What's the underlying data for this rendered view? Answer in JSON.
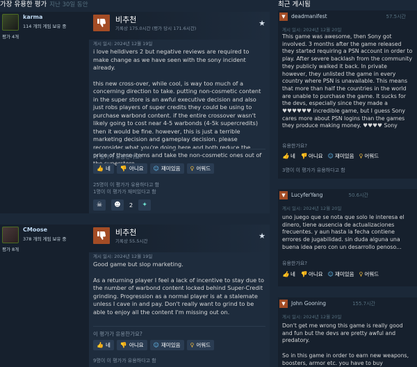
{
  "left_header": {
    "title": "가장 유용한 평가",
    "subtitle": "지난 30일 동안"
  },
  "right_header": {
    "title": "최근 게시됨"
  },
  "reviews": [
    {
      "author": "karma",
      "owned": "114 개의 게임 보유 중",
      "review_count": "평가 4개",
      "verdict": "비추천",
      "hours": "기록상 175.0시간 (평가 당시 171.6시간)",
      "posted": "게시 일시: 2024년 12월 19일",
      "paragraphs": [
        "i love helldivers 2 but negative reviews are required to make change as we have seen with the sony incident already.",
        "this new cross-over, while cool, is way too much of a concerning direction to take. putting non-cosmetic content in the super store is an awful executive decision and also just robs players of super credits they could be using to purchase warbond content. if the entire crossover wasn't likely going to cost near 4-5 warbonds (4-5k supercredits) then it would be fine. however, this is just a terrible marketing decision and gameplay decision. please reconsider what you're doing here and both reduce the price of these items and take the non-cosmetic ones out of the superstore."
      ],
      "helpful_question": "이 평가가 유용한가요?",
      "buttons": {
        "yes": "네",
        "no": "아니요",
        "funny": "재미있음",
        "award": "어워드"
      },
      "stats": [
        "25명이 이 평가가 유용하다고 함",
        "1명이 이 평가가 재미있다고 함"
      ],
      "award_count": "2"
    },
    {
      "author": "CMoose",
      "owned": "378 개의 게임 보유 중",
      "review_count": "평가 8개",
      "verdict": "비추천",
      "hours": "기록상 55.5시간",
      "posted": "게시 일시: 2024년 12월 19일",
      "paragraphs": [
        "Good game but slop marketing.",
        "As a returning player I feel a lack of incentive to stay due to the number of warbond content locked behind Super-Credit grinding. Progression as a normal player is at a stalemate unless I cave in and pay. Don't really want to grind to be able to enjoy all the content I'm missing out on."
      ],
      "helpful_question": "이 평가가 유용한가요?",
      "buttons": {
        "yes": "네",
        "no": "아니요",
        "funny": "재미있음",
        "award": "어워드"
      },
      "stats": [
        "9명이 이 평가가 유용하다고 함"
      ]
    }
  ],
  "recent": [
    {
      "author": "deadmanifest",
      "hours": "57.5시간",
      "posted": "게시 일시: 2024년 12월 20일",
      "text": "This game was awesome, then Sony got involved. 3 months after the game released they started requiring a PSN account in order to play. After severe backlash from the community they publicly walked it back. In private however, they unlisted the game in every country where PSN is unavailable. This means that more than half the countries in the world are unable to purchase the game. It sucks for the devs, especially since they made a ♥♥♥♥♥♥ incredible game, but I guess Sony cares more about PSN logins than the games they produce making money. ♥♥♥♥ Sony",
      "helpful_question": "유용한가요?",
      "buttons": {
        "yes": "네",
        "no": "아니요",
        "funny": "재미있음",
        "award": "어워드"
      },
      "stat": "3명이 이 평가가 유용하다고 함"
    },
    {
      "author": "LucyferYang",
      "hours": "50.6시간",
      "posted": "게시 일시: 2024년 12월 20일",
      "text": "uno juego que se nota que solo le interesa el dinero, tiene ausencia de actualizaciones frecuentes. y aun hasta la fecha contiene errores de jugabilidad. sin duda alguna una buena idea pero con un desarrollo penoso...",
      "helpful_question": "유용한가요?",
      "buttons": {
        "yes": "네",
        "no": "아니요",
        "funny": "재미있음",
        "award": "어워드"
      }
    },
    {
      "author": "John Gooning",
      "hours": "155.7시간",
      "posted": "게시 일시: 2024년 12월 20일",
      "text": "Don't get me wrong this game is really good and fun but the devs are pretty awful and predatory.\n\nSo in this game in order to earn new weapons, boosters, armor etc. you have to buy"
    }
  ],
  "colors": {
    "background": "#1b2838",
    "panel": "#1e2c3d",
    "negative": "#a34c25",
    "link": "#66c0f4"
  }
}
